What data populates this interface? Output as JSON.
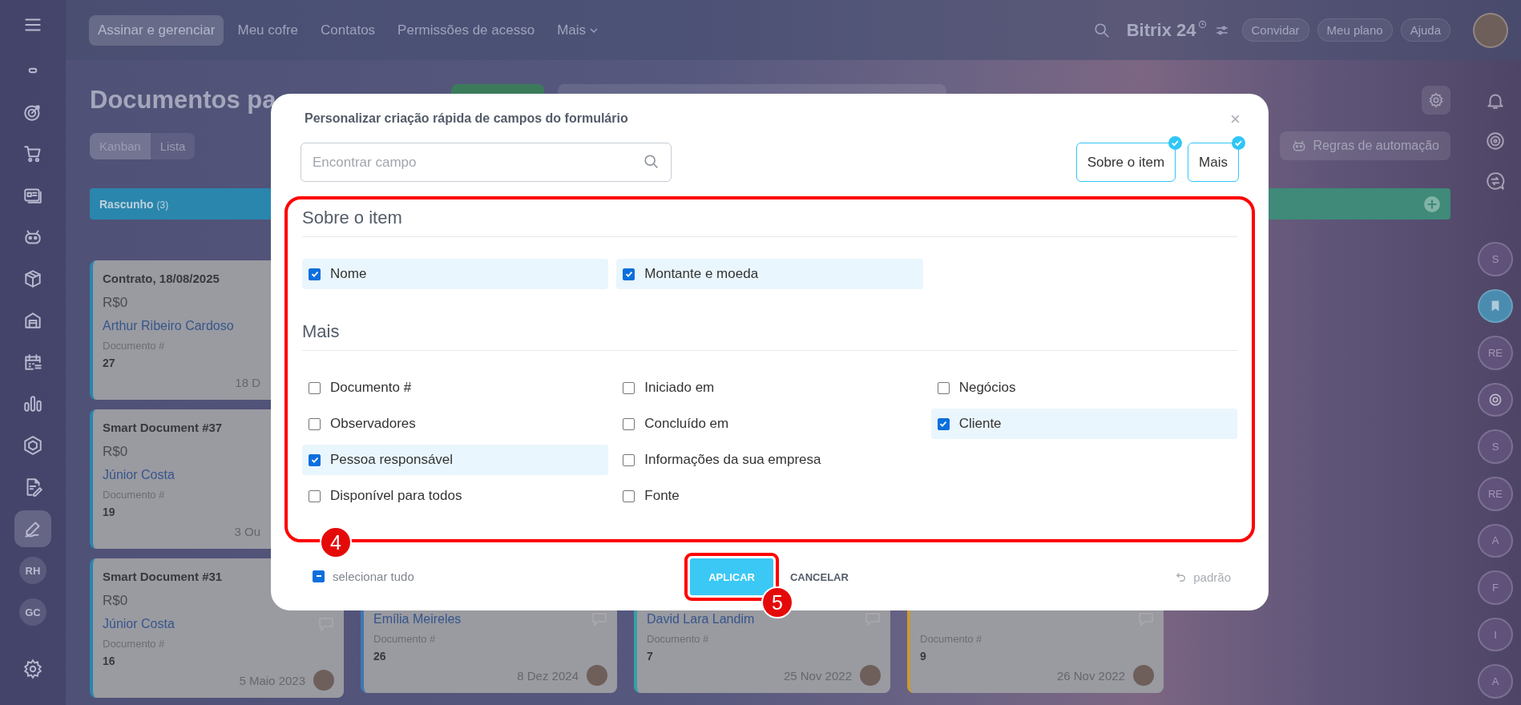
{
  "sidebar": {
    "items": [
      {
        "selected": false
      },
      {
        "selected": false
      },
      {
        "selected": false
      },
      {
        "selected": false
      },
      {
        "selected": false
      },
      {
        "selected": false
      },
      {
        "selected": false
      },
      {
        "selected": false
      },
      {
        "selected": false
      },
      {
        "selected": false
      },
      {
        "selected": false
      },
      {
        "selected": true
      },
      {
        "label": "RH",
        "selected": false
      },
      {
        "label": "GC",
        "selected": false
      }
    ]
  },
  "top_nav": {
    "tabs": [
      {
        "label": "Assinar e gerenciar",
        "selected": true,
        "dropdown": false
      },
      {
        "label": "Meu cofre",
        "selected": false,
        "dropdown": false
      },
      {
        "label": "Contatos",
        "selected": false,
        "dropdown": false
      },
      {
        "label": "Permissões de acesso",
        "selected": false,
        "dropdown": false
      },
      {
        "label": "Mais",
        "selected": false,
        "dropdown": true
      }
    ],
    "logo": "Bitrix 24",
    "buttons": [
      "Convidar",
      "Meu plano",
      "Ajuda"
    ]
  },
  "page_header": {
    "title": "Documentos pa",
    "view_toggle": [
      {
        "label": "Kanban",
        "selected": true
      },
      {
        "label": "Lista",
        "selected": false
      }
    ],
    "automation_button": "Regras de automação"
  },
  "kanban": {
    "columns": [
      {
        "title": "Rascunho",
        "count": "(3)",
        "color": "#2a86ad",
        "cards": [
          {
            "title": "Contrato, 18/08/2025",
            "amount": "R$0",
            "person": "Arthur Ribeiro Cardoso",
            "field_label": "Documento #",
            "field_value": "27",
            "date": "18 D",
            "avatar": false
          },
          {
            "title": "Smart Document #37",
            "amount": "R$0",
            "person": "Júnior Costa",
            "field_label": "Documento #",
            "field_value": "19",
            "date": "3 Ou",
            "avatar": false
          },
          {
            "title": "Smart Document #31",
            "amount": "R$0",
            "person": "Júnior Costa",
            "field_label": "Documento #",
            "field_value": "16",
            "date": "5 Maio 2023",
            "avatar": true,
            "comment_icon": true
          }
        ]
      },
      {
        "color": "#3f78b0",
        "cards": [
          {
            "person": "Emília Meireles",
            "field_label": "Documento #",
            "field_value": "26",
            "date": "8 Dez 2024",
            "avatar": true,
            "comment_icon": true
          }
        ]
      },
      {
        "color": "#3a9ea6",
        "cards": [
          {
            "person": "David Lara Landim",
            "field_label": "Documento #",
            "field_value": "7",
            "date": "25 Nov 2022",
            "avatar": true,
            "comment_icon": true
          }
        ]
      },
      {
        "color": "#c79b34",
        "cards": [
          {
            "field_label": "Documento #",
            "field_value": "9",
            "date": "26 Nov 2022",
            "avatar": true,
            "comment_icon": true
          }
        ]
      },
      {
        "color": "#3f8a78",
        "add_button": true
      }
    ]
  },
  "right_rail": {
    "contacts": [
      {
        "kind": "letter",
        "label": "S"
      },
      {
        "kind": "bookmark"
      },
      {
        "kind": "letter",
        "label": "RE"
      },
      {
        "kind": "logo"
      },
      {
        "kind": "letter",
        "label": "S"
      },
      {
        "kind": "letter",
        "label": "RE"
      },
      {
        "kind": "letter",
        "label": "A"
      },
      {
        "kind": "letter",
        "label": "F"
      },
      {
        "kind": "letter",
        "label": "I"
      },
      {
        "kind": "letter",
        "label": "A"
      }
    ]
  },
  "dialog": {
    "title": "Personalizar criação rápida de campos do formulário",
    "search": {
      "placeholder": "Encontrar campo"
    },
    "section_filters": [
      {
        "label": "Sobre o item",
        "selected": true
      },
      {
        "label": "Mais",
        "selected": true
      }
    ],
    "content_highlight": {
      "badge": "4"
    },
    "sections": [
      {
        "title": "Sobre o item",
        "columns": [
          {
            "fields": [
              {
                "label": "Nome",
                "checked": true
              }
            ]
          },
          {
            "fields": [
              {
                "label": "Montante e moeda",
                "checked": true
              }
            ]
          }
        ]
      },
      {
        "title": "Mais",
        "columns": [
          {
            "fields": [
              {
                "label": "Documento #",
                "checked": false
              },
              {
                "label": "Observadores",
                "checked": false
              },
              {
                "label": "Pessoa responsável",
                "checked": true
              },
              {
                "label": "Disponível para todos",
                "checked": false
              }
            ]
          },
          {
            "fields": [
              {
                "label": "Iniciado em",
                "checked": false
              },
              {
                "label": "Concluído em",
                "checked": false
              },
              {
                "label": "Informações da sua empresa",
                "checked": false
              },
              {
                "label": "Fonte",
                "checked": false
              }
            ]
          },
          {
            "fields": [
              {
                "label": "Negócios",
                "checked": false
              },
              {
                "label": "Cliente",
                "checked": true
              }
            ]
          }
        ]
      }
    ],
    "select_all": {
      "label": "selecionar tudo",
      "indeterminate": true
    },
    "apply_button": "APLICAR",
    "apply_highlight": {
      "badge": "5"
    },
    "cancel_button": "CANCELAR",
    "reset_link": "padrão"
  }
}
